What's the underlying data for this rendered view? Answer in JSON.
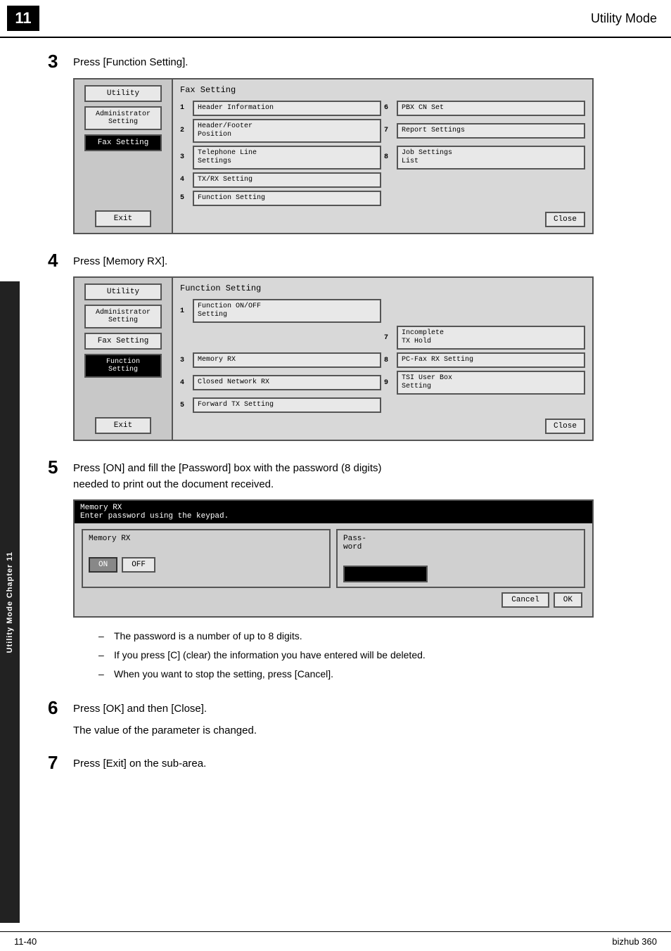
{
  "header": {
    "page_num": "11",
    "title": "Utility Mode"
  },
  "footer": {
    "left": "11-40",
    "right": "bizhub 360"
  },
  "sidebar": {
    "chapter_label": "Chapter 11",
    "mode_label": "Utility Mode"
  },
  "step3": {
    "num": "3",
    "text": "Press [Function Setting].",
    "panel": {
      "sidebar_items": [
        {
          "label": "Utility",
          "style": "normal"
        },
        {
          "label": "Administrator\nSetting",
          "style": "normal"
        },
        {
          "label": "Fax Setting",
          "style": "highlighted"
        }
      ],
      "exit_btn": "Exit",
      "main_title": "Fax Setting",
      "grid": [
        {
          "num": "1",
          "label": "Header Information"
        },
        {
          "num": "6",
          "label": "PBX CN Set"
        },
        {
          "num": "2",
          "label": "Header/Footer\nPosition"
        },
        {
          "num": "7",
          "label": "Report Settings"
        },
        {
          "num": "3",
          "label": "Telephone Line\nSettings"
        },
        {
          "num": "8",
          "label": "Job Settings\nList"
        },
        {
          "num": "4",
          "label": "TX/RX Setting"
        },
        {
          "num": "",
          "label": ""
        },
        {
          "num": "5",
          "label": "Function Setting"
        },
        {
          "num": "",
          "label": ""
        }
      ],
      "close_btn": "Close"
    }
  },
  "step4": {
    "num": "4",
    "text": "Press [Memory RX].",
    "panel": {
      "sidebar_items": [
        {
          "label": "Utility",
          "style": "normal"
        },
        {
          "label": "Administrator\nSetting",
          "style": "normal"
        },
        {
          "label": "Fax Setting",
          "style": "normal"
        },
        {
          "label": "Function Setting",
          "style": "highlighted"
        }
      ],
      "exit_btn": "Exit",
      "main_title": "Function Setting",
      "grid": [
        {
          "num": "1",
          "label": "Function ON/OFF\nSetting"
        },
        {
          "num": "",
          "label": ""
        },
        {
          "num": "",
          "label": ""
        },
        {
          "num": "7",
          "label": "Incomplete\nTX Hold"
        },
        {
          "num": "3",
          "label": "Memory RX"
        },
        {
          "num": "8",
          "label": "PC-Fax RX Setting"
        },
        {
          "num": "4",
          "label": "Closed Network RX"
        },
        {
          "num": "9",
          "label": "TSI User Box\nSetting"
        },
        {
          "num": "5",
          "label": "Forward TX Setting"
        },
        {
          "num": "",
          "label": ""
        }
      ],
      "close_btn": "Close"
    }
  },
  "step5": {
    "num": "5",
    "text": "Press [ON] and fill the [Password] box with the password (8 digits)\nneeded to print out the document received.",
    "memory_panel": {
      "header_line1": "Memory RX",
      "header_line2": "Enter password using the keypad.",
      "memory_rx_label": "Memory RX",
      "password_label": "Pass-\nword",
      "on_btn": "ON",
      "off_btn": "OFF",
      "cancel_btn": "Cancel",
      "ok_btn": "OK"
    },
    "bullets": [
      "The password is a number of up to 8 digits.",
      "If you press [C] (clear) the information you have entered will be deleted.",
      "When you want to stop the setting, press [Cancel]."
    ]
  },
  "step6": {
    "num": "6",
    "text": "Press [OK] and then [Close].",
    "subtext": "The value of the parameter is changed."
  },
  "step7": {
    "num": "7",
    "text": "Press [Exit] on the sub-area."
  }
}
